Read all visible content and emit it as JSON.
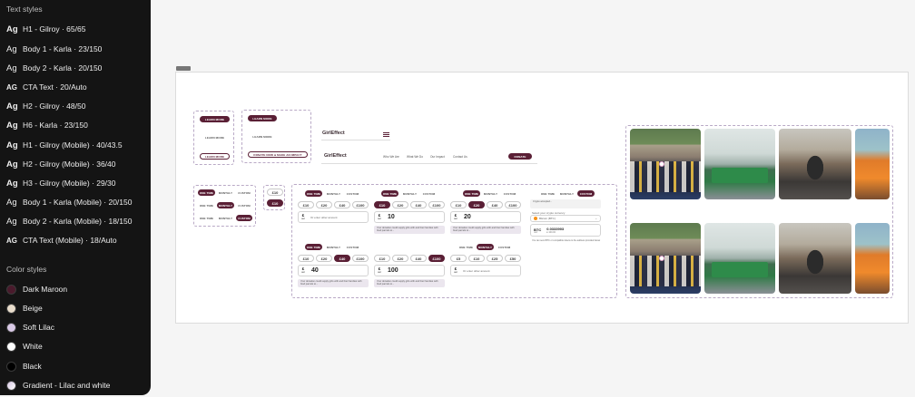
{
  "panel": {
    "text_styles_title": "Text styles",
    "text_styles": [
      {
        "glyph": "Ag",
        "label": "H1 - Gilroy · 65/65"
      },
      {
        "glyph": "Ag",
        "label": "Body 1 - Karla · 23/150"
      },
      {
        "glyph": "Ag",
        "label": "Body 2 - Karla · 20/150"
      },
      {
        "glyph": "AG",
        "label": "CTA Text · 20/Auto"
      },
      {
        "glyph": "Ag",
        "label": "H2 - Gilroy · 48/50"
      },
      {
        "glyph": "Ag",
        "label": "H6 - Karla · 23/150"
      },
      {
        "glyph": "Ag",
        "label": "H1 - Gilroy (Mobile) · 40/43.5"
      },
      {
        "glyph": "Ag",
        "label": "H2 - Gilroy (Mobile) · 36/40"
      },
      {
        "glyph": "Ag",
        "label": "H3 - Gilroy (Mobile) · 29/30"
      },
      {
        "glyph": "Ag",
        "label": "Body 1 - Karla (Mobile) · 20/150"
      },
      {
        "glyph": "Ag",
        "label": "Body 2 - Karla (Mobile) · 18/150"
      },
      {
        "glyph": "AG",
        "label": "CTA Text (Mobile) · 18/Auto"
      }
    ],
    "color_styles_title": "Color styles",
    "color_styles": [
      {
        "label": "Dark Maroon",
        "color": "#4a1a2c"
      },
      {
        "label": "Beige",
        "color": "#e8dccb"
      },
      {
        "label": "Soft Lilac",
        "color": "#d9c9e6"
      },
      {
        "label": "White",
        "color": "#ffffff"
      },
      {
        "label": "Black",
        "color": "#000000"
      },
      {
        "label": "Gradient - Lilac and white",
        "color": "#d7c8e4"
      }
    ]
  },
  "canvas": {
    "buttons": {
      "learn_more": "LEARN MORE",
      "donate_now": "DONATE NOW & MAKE AN IMPACT",
      "donate": "DONATE"
    },
    "logo": "GirlEffect",
    "nav": [
      "Who We Are",
      "What We Do",
      "Our Impact",
      "Contact Us"
    ],
    "frequency": [
      "ONE TIME",
      "MONTHLY",
      "CUSTOM"
    ],
    "amounts": [
      "£10",
      "£20",
      "£40",
      "£100"
    ],
    "amounts_small": [
      "£5",
      "£10",
      "£25",
      "£50"
    ],
    "currency": "£",
    "currency_sub": "GBP",
    "values": {
      "a": "10",
      "b": "20",
      "c": "40",
      "d": "100"
    },
    "other_amount": "Or enter other amount",
    "impact_note": "Your donation could supply girls with and their families with food parcels to...",
    "crypto": {
      "heading": "Crypto accepted...",
      "select_label": "Select your crypto currency",
      "asset": "Bitcoin (BTC)",
      "code": "BTC",
      "amount": "0.0333903",
      "fiat": "£ 100.00",
      "footer": "You can send BTC or compatible tokens to the address provided below"
    },
    "brand_color": "#5a1f35",
    "accent_lilac": "#b9a9c6"
  }
}
